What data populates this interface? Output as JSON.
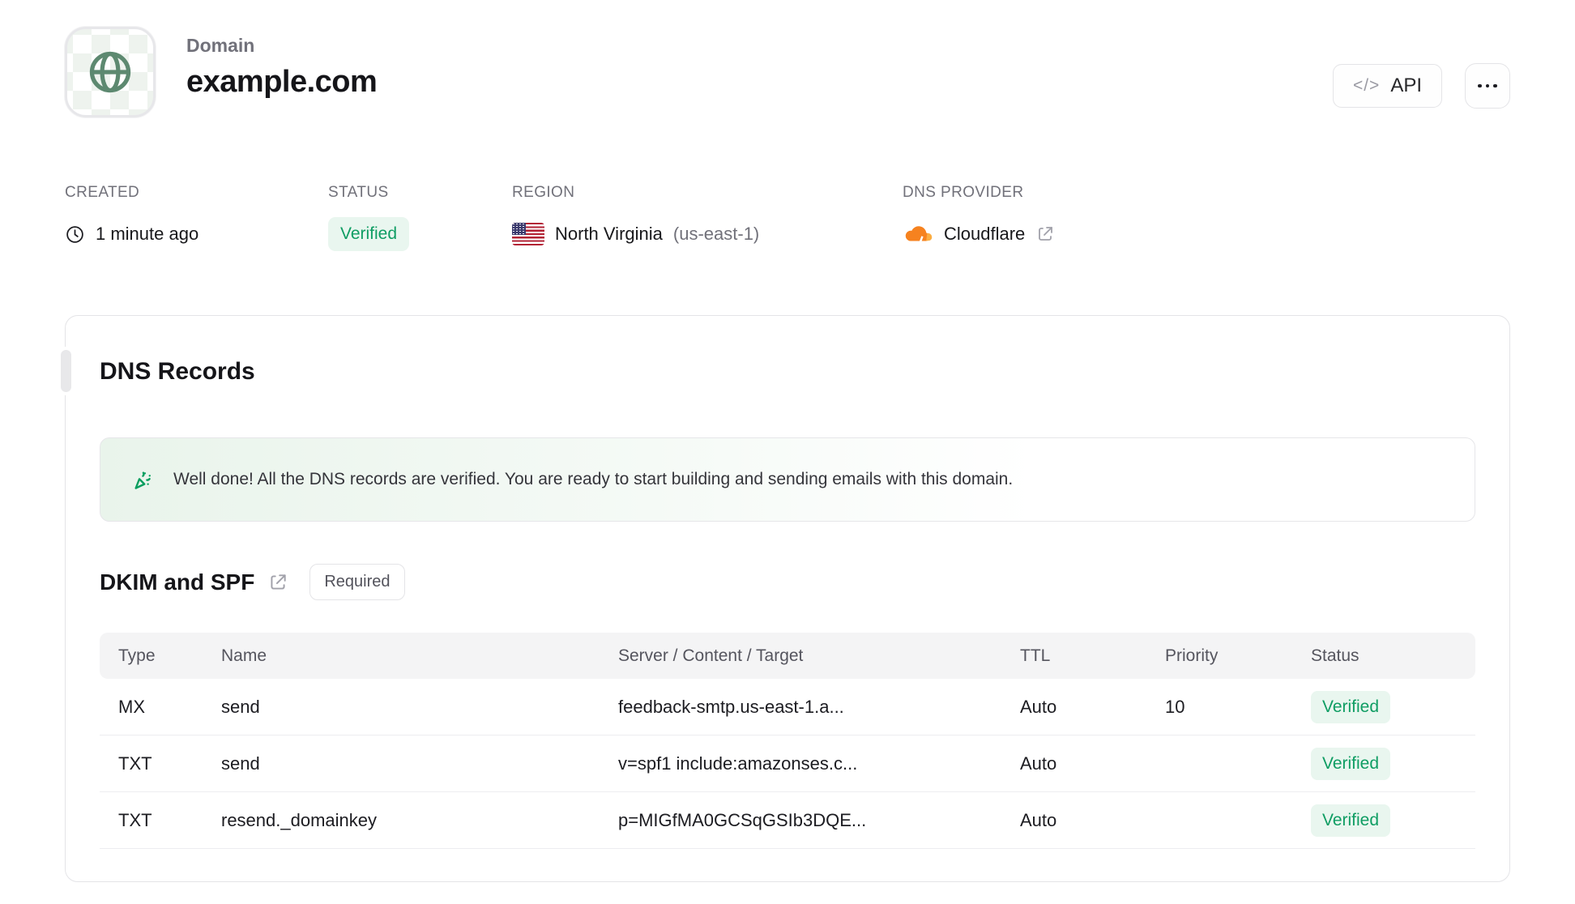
{
  "header": {
    "label": "Domain",
    "domain": "example.com",
    "api_button": "API",
    "api_code_glyph": "</>"
  },
  "meta": {
    "created": {
      "label": "CREATED",
      "value": "1 minute ago"
    },
    "status": {
      "label": "STATUS",
      "value": "Verified"
    },
    "region": {
      "label": "REGION",
      "name": "North Virginia",
      "code": "(us-east-1)"
    },
    "dns_provider": {
      "label": "DNS PROVIDER",
      "value": "Cloudflare"
    }
  },
  "dns_card": {
    "title": "DNS Records",
    "banner": {
      "text": "Well done! All the DNS records are verified. You are ready to start building and sending emails with this domain."
    },
    "section": {
      "title": "DKIM and SPF",
      "badge": "Required"
    },
    "table": {
      "columns": [
        "Type",
        "Name",
        "Server / Content / Target",
        "TTL",
        "Priority",
        "Status"
      ],
      "rows": [
        {
          "type": "MX",
          "name": "send",
          "content": "feedback-smtp.us-east-1.a...",
          "ttl": "Auto",
          "priority": "10",
          "status": "Verified"
        },
        {
          "type": "TXT",
          "name": "send",
          "content": "v=spf1 include:amazonses.c...",
          "ttl": "Auto",
          "priority": "",
          "status": "Verified"
        },
        {
          "type": "TXT",
          "name": "resend._domainkey",
          "content": "p=MIGfMA0GCSqGSIb3DQE...",
          "ttl": "Auto",
          "priority": "",
          "status": "Verified"
        }
      ]
    }
  },
  "icons": {
    "tile": "globe-icon",
    "created": "clock-icon",
    "region": "us-flag-icon",
    "dns_provider": "cloudflare-icon",
    "provider_link": "external-link-icon",
    "banner": "party-popper-icon",
    "section_link": "external-link-icon",
    "api": "code-icon",
    "more": "ellipsis-icon"
  },
  "colors": {
    "accent_green": "#0f9d63",
    "badge_bg": "#e9f6ef",
    "banner_gradient_start": "#e9f4eb",
    "border": "#e4e4e7",
    "table_header_bg": "#f4f4f5",
    "text_dark": "#18181b",
    "text_gray": "#71717a",
    "cloudflare_orange": "#f6821f"
  }
}
